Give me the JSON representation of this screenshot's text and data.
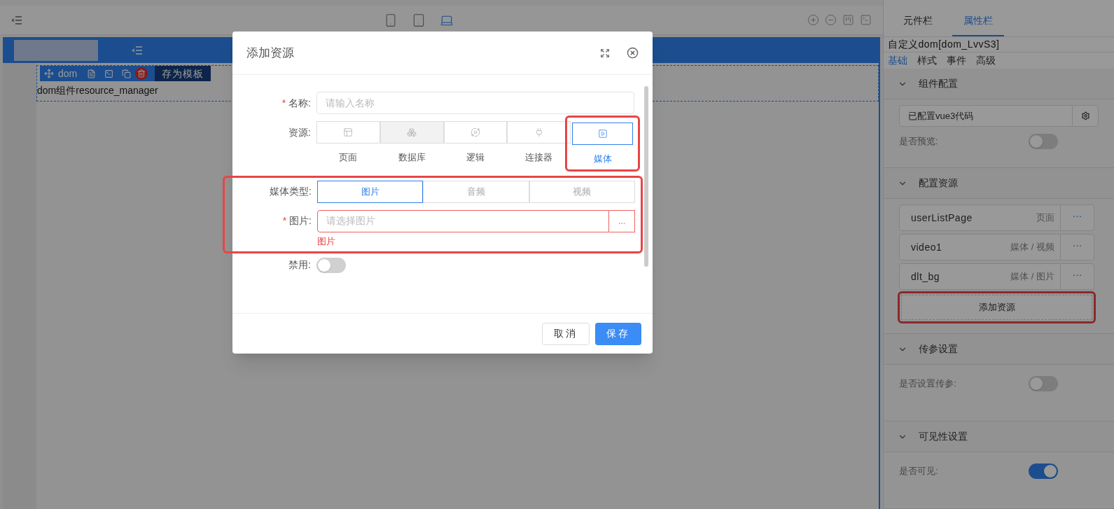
{
  "toolbar": {
    "devices": [
      {
        "selected": false
      },
      {
        "selected": false
      },
      {
        "selected": true
      }
    ]
  },
  "canvas": {
    "component": {
      "label": "dom",
      "save_template": "存为模板",
      "content": "dom组件resource_manager"
    }
  },
  "dialog": {
    "title": "添加资源",
    "name_field": {
      "label": "名称:",
      "required_mark": "*",
      "placeholder": "请输入名称"
    },
    "source_field": {
      "label": "资源:",
      "options": [
        {
          "label": "页面",
          "selected": false,
          "hovered": false
        },
        {
          "label": "数据库",
          "selected": false,
          "hovered": true
        },
        {
          "label": "逻辑",
          "selected": false,
          "hovered": false
        },
        {
          "label": "连接器",
          "selected": false,
          "hovered": false
        },
        {
          "label": "媒体",
          "selected": true,
          "hovered": false
        }
      ]
    },
    "media_type_field": {
      "label": "媒体类型:",
      "options": [
        {
          "label": "图片",
          "selected": true
        },
        {
          "label": "音频",
          "selected": false
        },
        {
          "label": "视频",
          "selected": false
        }
      ]
    },
    "image_field": {
      "label": "图片:",
      "required_mark": "*",
      "placeholder": "请选择图片",
      "button": "...",
      "error": "图片"
    },
    "disabled_field": {
      "label": "禁用:",
      "on": false
    },
    "buttons": [
      {
        "label": "取消",
        "kind": "secondary"
      },
      {
        "label": "保存",
        "kind": "primary"
      }
    ]
  },
  "panel": {
    "tabs": [
      {
        "label": "元件栏",
        "selected": false
      },
      {
        "label": "属性栏",
        "selected": true
      }
    ],
    "title": "自定义dom[dom_LvvS3]",
    "subtabs": [
      {
        "label": "基础",
        "selected": true
      },
      {
        "label": "样式",
        "selected": false
      },
      {
        "label": "事件",
        "selected": false
      },
      {
        "label": "高级",
        "selected": false
      }
    ],
    "sections": [
      {
        "kind": "config",
        "title": "组件配置",
        "expanded": true,
        "code_value": "已配置vue3代码",
        "toggle_label": "是否预览:",
        "on": false
      },
      {
        "kind": "resources",
        "title": "配置资源",
        "expanded": true,
        "resources": [
          {
            "name": "userListPage",
            "type": "页面",
            "more_button": "···"
          },
          {
            "name": "video1",
            "type": "媒体 / 视频",
            "more_button": "···"
          },
          {
            "name": "dlt_bg",
            "type": "媒体 / 图片",
            "more_button": "···"
          }
        ],
        "add_button": "添加资源"
      },
      {
        "kind": "toggle",
        "title": "传参设置",
        "expanded": true,
        "toggle_label": "是否设置传参:",
        "on": false
      },
      {
        "kind": "toggle",
        "title": "可见性设置",
        "expanded": true,
        "toggle_label": "是否可见:",
        "on": true
      }
    ]
  }
}
